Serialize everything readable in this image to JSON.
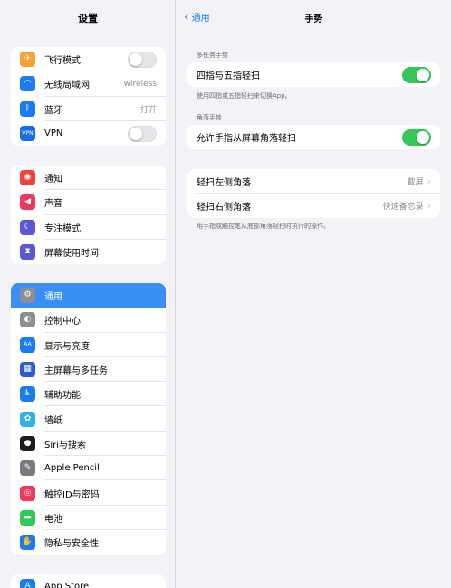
{
  "sidebar": {
    "title": "设置",
    "group1": [
      {
        "id": "airplane",
        "label": "飞行模式",
        "icon": "airplane-icon",
        "glyph": "✈",
        "color": "#f7a033",
        "toggle": false
      },
      {
        "id": "wifi",
        "label": "无线局域网",
        "icon": "wifi-icon",
        "glyph": "◠",
        "color": "#1a7cf5",
        "value": "wireless"
      },
      {
        "id": "bluetooth",
        "label": "蓝牙",
        "icon": "bluetooth-icon",
        "glyph": "ᛒ",
        "color": "#1a7cf5",
        "value": "打开"
      },
      {
        "id": "vpn",
        "label": "VPN",
        "icon": "vpn-icon",
        "glyph": "VPN",
        "color": "#1a6ee0",
        "toggle": false
      }
    ],
    "group2": [
      {
        "id": "notifications",
        "label": "通知",
        "icon": "notifications-icon",
        "glyph": "◉",
        "color": "#f0443a"
      },
      {
        "id": "sounds",
        "label": "声音",
        "icon": "speaker-icon",
        "glyph": "◀",
        "color": "#f0385a"
      },
      {
        "id": "focus",
        "label": "专注模式",
        "icon": "moon-icon",
        "glyph": "☾",
        "color": "#5b56d6"
      },
      {
        "id": "screentime",
        "label": "屏幕使用时间",
        "icon": "hourglass-icon",
        "glyph": "⧗",
        "color": "#5b56d6"
      }
    ],
    "group3": [
      {
        "id": "general",
        "label": "通用",
        "icon": "gear-icon",
        "glyph": "⚙",
        "color": "#8e8e93",
        "selected": true
      },
      {
        "id": "control",
        "label": "控制中心",
        "icon": "control-center-icon",
        "glyph": "◐",
        "color": "#8e8e93"
      },
      {
        "id": "display",
        "label": "显示与亮度",
        "icon": "display-icon",
        "glyph": "AA",
        "color": "#1a7cf5"
      },
      {
        "id": "homescreen",
        "label": "主屏幕与多任务",
        "icon": "homescreen-icon",
        "glyph": "▦",
        "color": "#2c5bd8"
      },
      {
        "id": "accessibility",
        "label": "辅助功能",
        "icon": "accessibility-icon",
        "glyph": "♿",
        "color": "#1a7cf5"
      },
      {
        "id": "wallpaper",
        "label": "墙纸",
        "icon": "wallpaper-icon",
        "glyph": "✿",
        "color": "#2fb3e6"
      },
      {
        "id": "siri",
        "label": "Siri与搜索",
        "icon": "siri-icon",
        "glyph": "●",
        "color": "#1c1c1e"
      },
      {
        "id": "pencil",
        "label": "Apple Pencil",
        "icon": "pencil-icon",
        "glyph": "✎",
        "color": "#7a7a80"
      },
      {
        "id": "touchid",
        "label": "触控ID与密码",
        "icon": "fingerprint-icon",
        "glyph": "◎",
        "color": "#f0385a"
      },
      {
        "id": "battery",
        "label": "电池",
        "icon": "battery-icon",
        "glyph": "▬",
        "color": "#34c759"
      },
      {
        "id": "privacy",
        "label": "隐私与安全性",
        "icon": "hand-icon",
        "glyph": "✋",
        "color": "#1a7cf5"
      }
    ],
    "group4": [
      {
        "id": "appstore",
        "label": "App Store",
        "icon": "appstore-icon",
        "glyph": "A",
        "color": "#1a7cf5"
      }
    ]
  },
  "main": {
    "back_label": "通用",
    "title": "手势",
    "section1_label": "多任务手势",
    "four_five_finger": {
      "label": "四指与五指轻扫",
      "toggle": true
    },
    "section1_note": "使用四指或五指轻扫来切换App。",
    "section2_label": "角落手势",
    "corner_swipe": {
      "label": "允许手指从屏幕角落轻扫",
      "toggle": true
    },
    "left_corner": {
      "label": "轻扫左侧角落",
      "value": "截屏"
    },
    "right_corner": {
      "label": "轻扫右侧角落",
      "value": "快速备忘录"
    },
    "section2_note": "用手指或触控笔从底部角落轻扫时执行的操作。"
  }
}
